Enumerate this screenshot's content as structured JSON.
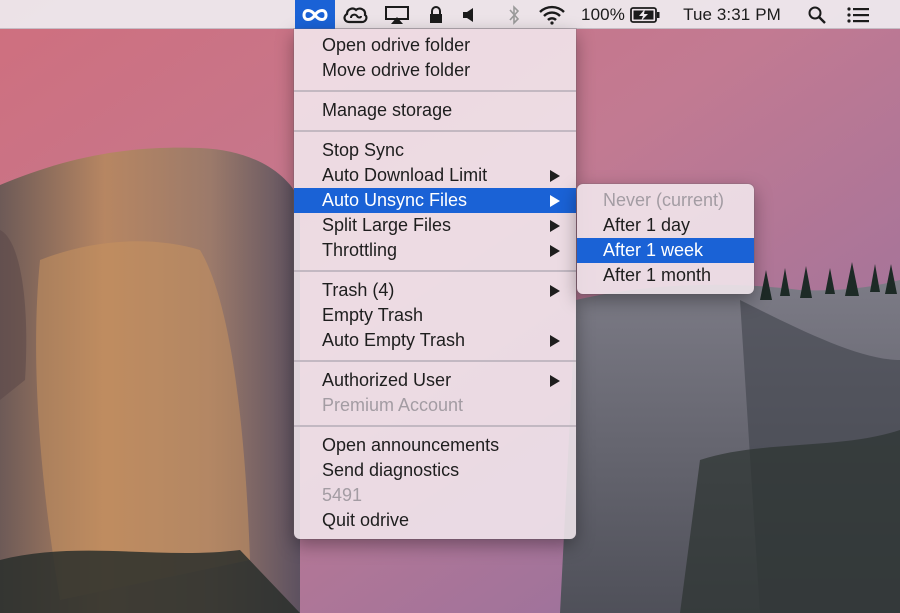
{
  "menubar": {
    "battery_percent": "100%",
    "clock": "Tue 3:31 PM",
    "icons": [
      "odrive-icon",
      "creative-cloud-icon",
      "airplay-icon",
      "lock-icon",
      "volume-icon",
      "bluetooth-icon",
      "wifi-icon",
      "battery-charging-icon",
      "spotlight-search-icon",
      "notification-center-icon"
    ],
    "accent_color": "#1a62d6"
  },
  "main_menu": {
    "open_folder": "Open odrive folder",
    "move_folder": "Move odrive folder",
    "manage_storage": "Manage storage",
    "stop_sync": "Stop Sync",
    "auto_download_limit": "Auto Download Limit",
    "auto_unsync_files": "Auto Unsync Files",
    "split_large_files": "Split Large Files",
    "throttling": "Throttling",
    "trash": "Trash (4)",
    "empty_trash": "Empty Trash",
    "auto_empty_trash": "Auto Empty Trash",
    "authorized_user": "Authorized User",
    "premium_account": "Premium Account",
    "open_announcements": "Open announcements",
    "send_diagnostics": "Send diagnostics",
    "version": "5491",
    "quit": "Quit odrive"
  },
  "submenu": {
    "never": "Never (current)",
    "after_1_day": "After 1 day",
    "after_1_week": "After 1 week",
    "after_1_month": "After 1 month"
  }
}
